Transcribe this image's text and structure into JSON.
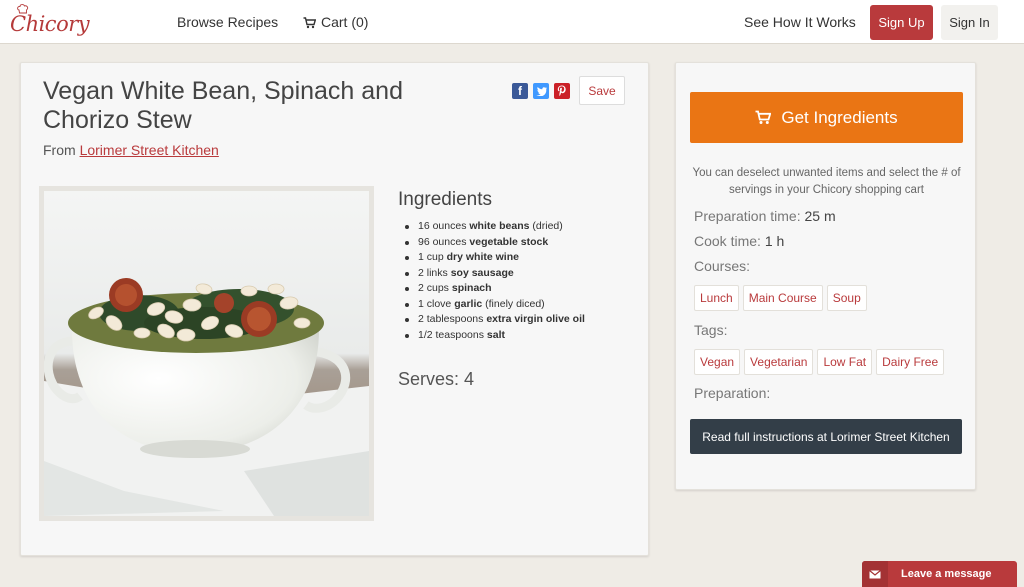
{
  "header": {
    "logo_text": "Chicory",
    "nav": {
      "browse": "Browse Recipes",
      "cart": "Cart (0)",
      "how": "See How It Works"
    },
    "signup": "Sign Up",
    "signin": "Sign In"
  },
  "recipe": {
    "title": "Vegan White Bean, Spinach and Chorizo Stew",
    "from_prefix": "From",
    "from_source": "Lorimer Street Kitchen",
    "save_label": "Save",
    "share_icons": [
      "facebook-icon",
      "twitter-icon",
      "pinterest-icon"
    ],
    "ingredients_title": "Ingredients",
    "ingredients": [
      {
        "qty": "16 ounces",
        "item": "white beans",
        "note": "(dried)"
      },
      {
        "qty": "96 ounces",
        "item": "vegetable stock",
        "note": ""
      },
      {
        "qty": "1 cup",
        "item": "dry white wine",
        "note": ""
      },
      {
        "qty": "2 links",
        "item": "soy sausage",
        "note": ""
      },
      {
        "qty": "2 cups",
        "item": "spinach",
        "note": ""
      },
      {
        "qty": "1 clove",
        "item": "garlic",
        "note": "(finely diced)"
      },
      {
        "qty": "2 tablespoons",
        "item": "extra virgin olive oil",
        "note": ""
      },
      {
        "qty": "1/2 teaspoons",
        "item": "salt",
        "note": ""
      }
    ],
    "serves": "Serves: 4"
  },
  "sidebar": {
    "get_ingredients": "Get Ingredients",
    "note": "You can deselect unwanted items and select the # of servings in your Chicory shopping cart",
    "prep_label": "Preparation time:",
    "prep_value": "25 m",
    "cook_label": "Cook time:",
    "cook_value": "1 h",
    "courses_label": "Courses:",
    "courses": [
      "Lunch",
      "Main Course",
      "Soup"
    ],
    "tags_label": "Tags:",
    "tags": [
      "Vegan",
      "Vegetarian",
      "Low Fat",
      "Dairy Free"
    ],
    "preparation_label": "Preparation:",
    "read_full": "Read full instructions at Lorimer Street Kitchen"
  },
  "chat": {
    "label": "Leave a message"
  },
  "colors": {
    "brand_red": "#b93a3c",
    "accent_orange": "#ea7514",
    "dark_button": "#333e48",
    "page_bg": "#efece6"
  }
}
